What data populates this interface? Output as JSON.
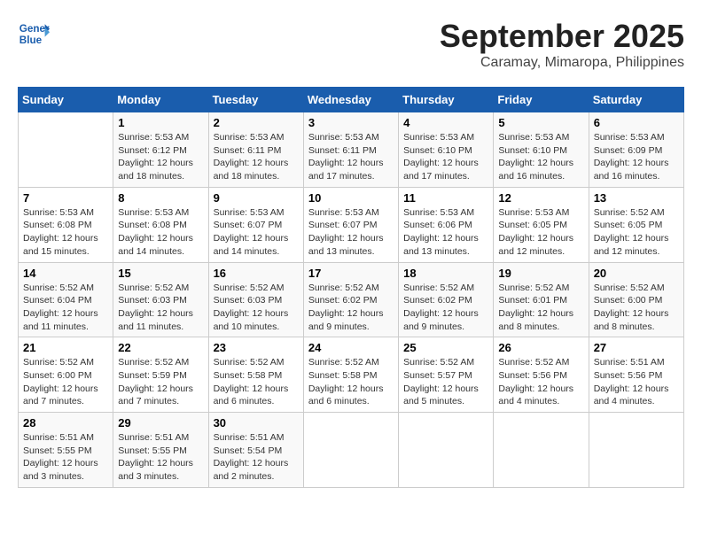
{
  "header": {
    "month_year": "September 2025",
    "location": "Caramay, Mimaropa, Philippines"
  },
  "logo": {
    "line1": "General",
    "line2": "Blue"
  },
  "days_of_week": [
    "Sunday",
    "Monday",
    "Tuesday",
    "Wednesday",
    "Thursday",
    "Friday",
    "Saturday"
  ],
  "weeks": [
    [
      {
        "day": "",
        "info": ""
      },
      {
        "day": "1",
        "info": "Sunrise: 5:53 AM\nSunset: 6:12 PM\nDaylight: 12 hours\nand 18 minutes."
      },
      {
        "day": "2",
        "info": "Sunrise: 5:53 AM\nSunset: 6:11 PM\nDaylight: 12 hours\nand 18 minutes."
      },
      {
        "day": "3",
        "info": "Sunrise: 5:53 AM\nSunset: 6:11 PM\nDaylight: 12 hours\nand 17 minutes."
      },
      {
        "day": "4",
        "info": "Sunrise: 5:53 AM\nSunset: 6:10 PM\nDaylight: 12 hours\nand 17 minutes."
      },
      {
        "day": "5",
        "info": "Sunrise: 5:53 AM\nSunset: 6:10 PM\nDaylight: 12 hours\nand 16 minutes."
      },
      {
        "day": "6",
        "info": "Sunrise: 5:53 AM\nSunset: 6:09 PM\nDaylight: 12 hours\nand 16 minutes."
      }
    ],
    [
      {
        "day": "7",
        "info": "Sunrise: 5:53 AM\nSunset: 6:08 PM\nDaylight: 12 hours\nand 15 minutes."
      },
      {
        "day": "8",
        "info": "Sunrise: 5:53 AM\nSunset: 6:08 PM\nDaylight: 12 hours\nand 14 minutes."
      },
      {
        "day": "9",
        "info": "Sunrise: 5:53 AM\nSunset: 6:07 PM\nDaylight: 12 hours\nand 14 minutes."
      },
      {
        "day": "10",
        "info": "Sunrise: 5:53 AM\nSunset: 6:07 PM\nDaylight: 12 hours\nand 13 minutes."
      },
      {
        "day": "11",
        "info": "Sunrise: 5:53 AM\nSunset: 6:06 PM\nDaylight: 12 hours\nand 13 minutes."
      },
      {
        "day": "12",
        "info": "Sunrise: 5:53 AM\nSunset: 6:05 PM\nDaylight: 12 hours\nand 12 minutes."
      },
      {
        "day": "13",
        "info": "Sunrise: 5:52 AM\nSunset: 6:05 PM\nDaylight: 12 hours\nand 12 minutes."
      }
    ],
    [
      {
        "day": "14",
        "info": "Sunrise: 5:52 AM\nSunset: 6:04 PM\nDaylight: 12 hours\nand 11 minutes."
      },
      {
        "day": "15",
        "info": "Sunrise: 5:52 AM\nSunset: 6:03 PM\nDaylight: 12 hours\nand 11 minutes."
      },
      {
        "day": "16",
        "info": "Sunrise: 5:52 AM\nSunset: 6:03 PM\nDaylight: 12 hours\nand 10 minutes."
      },
      {
        "day": "17",
        "info": "Sunrise: 5:52 AM\nSunset: 6:02 PM\nDaylight: 12 hours\nand 9 minutes."
      },
      {
        "day": "18",
        "info": "Sunrise: 5:52 AM\nSunset: 6:02 PM\nDaylight: 12 hours\nand 9 minutes."
      },
      {
        "day": "19",
        "info": "Sunrise: 5:52 AM\nSunset: 6:01 PM\nDaylight: 12 hours\nand 8 minutes."
      },
      {
        "day": "20",
        "info": "Sunrise: 5:52 AM\nSunset: 6:00 PM\nDaylight: 12 hours\nand 8 minutes."
      }
    ],
    [
      {
        "day": "21",
        "info": "Sunrise: 5:52 AM\nSunset: 6:00 PM\nDaylight: 12 hours\nand 7 minutes."
      },
      {
        "day": "22",
        "info": "Sunrise: 5:52 AM\nSunset: 5:59 PM\nDaylight: 12 hours\nand 7 minutes."
      },
      {
        "day": "23",
        "info": "Sunrise: 5:52 AM\nSunset: 5:58 PM\nDaylight: 12 hours\nand 6 minutes."
      },
      {
        "day": "24",
        "info": "Sunrise: 5:52 AM\nSunset: 5:58 PM\nDaylight: 12 hours\nand 6 minutes."
      },
      {
        "day": "25",
        "info": "Sunrise: 5:52 AM\nSunset: 5:57 PM\nDaylight: 12 hours\nand 5 minutes."
      },
      {
        "day": "26",
        "info": "Sunrise: 5:52 AM\nSunset: 5:56 PM\nDaylight: 12 hours\nand 4 minutes."
      },
      {
        "day": "27",
        "info": "Sunrise: 5:51 AM\nSunset: 5:56 PM\nDaylight: 12 hours\nand 4 minutes."
      }
    ],
    [
      {
        "day": "28",
        "info": "Sunrise: 5:51 AM\nSunset: 5:55 PM\nDaylight: 12 hours\nand 3 minutes."
      },
      {
        "day": "29",
        "info": "Sunrise: 5:51 AM\nSunset: 5:55 PM\nDaylight: 12 hours\nand 3 minutes."
      },
      {
        "day": "30",
        "info": "Sunrise: 5:51 AM\nSunset: 5:54 PM\nDaylight: 12 hours\nand 2 minutes."
      },
      {
        "day": "",
        "info": ""
      },
      {
        "day": "",
        "info": ""
      },
      {
        "day": "",
        "info": ""
      },
      {
        "day": "",
        "info": ""
      }
    ]
  ]
}
